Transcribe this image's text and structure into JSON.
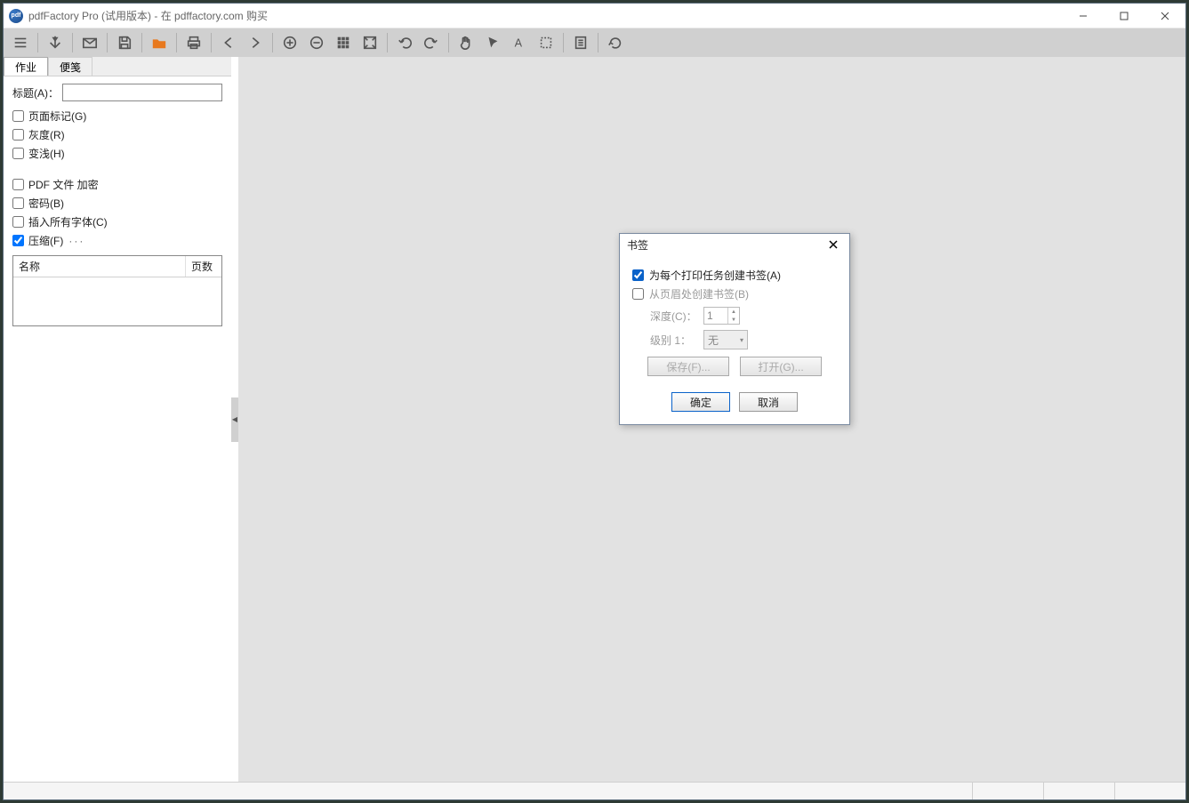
{
  "title": "pdfFactory Pro (试用版本) - 在 pdffactory.com 购买",
  "app_icon_text": "pdf",
  "tabs": {
    "job": "作业",
    "notes": "便笺"
  },
  "sidebar": {
    "title_label": "标题(A)：",
    "title_value": "",
    "page_mark": "页面标记(G)",
    "gray": "灰度(R)",
    "fade": "变浅(H)",
    "encrypt": "PDF 文件 加密",
    "password": "密码(B)",
    "embed_fonts": "插入所有字体(C)",
    "compress": "压缩(F)",
    "ellipsis": "···",
    "list": {
      "name": "名称",
      "pages": "页数"
    }
  },
  "dialog": {
    "title": "书签",
    "opt_each_job": "为每个打印任务创建书签(A)",
    "opt_from_header": "从页眉处创建书签(B)",
    "depth_label": "深度(C)：",
    "depth_value": "1",
    "level_label": "级别 1：",
    "level_value": "无",
    "save": "保存(F)...",
    "open": "打开(G)...",
    "ok": "确定",
    "cancel": "取消"
  },
  "icons": {
    "menu": "menu",
    "pdf": "pdf",
    "mail": "mail",
    "save": "save",
    "open": "open",
    "print": "print",
    "back": "back",
    "forward": "forward",
    "zoomin": "zoomin",
    "zoomout": "zoomout",
    "grid": "grid",
    "fit": "fit",
    "undo": "undo",
    "redo": "redo",
    "hand": "hand",
    "pointer": "pointer",
    "text": "text",
    "select": "select",
    "note": "note",
    "refresh": "refresh"
  }
}
